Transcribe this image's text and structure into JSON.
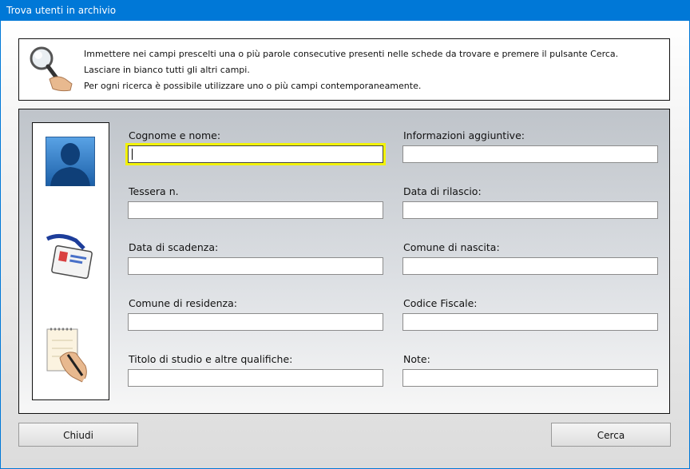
{
  "window": {
    "title": "Trova utenti in archivio"
  },
  "info": {
    "line1": "Immettere nei campi prescelti una o più parole consecutive presenti nelle schede da trovare e premere il pulsante Cerca.",
    "line2": "Lasciare in bianco tutti gli altri campi.",
    "line3": "Per ogni ricerca è possibile utilizzare uno o più campi contemporaneamente."
  },
  "fields": {
    "cognome_nome": {
      "label": "Cognome e nome:",
      "value": ""
    },
    "info_aggiuntive": {
      "label": "Informazioni aggiuntive:",
      "value": ""
    },
    "tessera": {
      "label": "Tessera n.",
      "value": ""
    },
    "data_rilascio": {
      "label": "Data di rilascio:",
      "value": ""
    },
    "data_scadenza": {
      "label": "Data di scadenza:",
      "value": ""
    },
    "comune_nascita": {
      "label": "Comune di nascita:",
      "value": ""
    },
    "comune_residenza": {
      "label": "Comune di residenza:",
      "value": ""
    },
    "codice_fiscale": {
      "label": "Codice Fiscale:",
      "value": ""
    },
    "titolo_studio": {
      "label": "Titolo di studio e altre qualifiche:",
      "value": ""
    },
    "note": {
      "label": "Note:",
      "value": ""
    }
  },
  "buttons": {
    "close": "Chiudi",
    "search": "Cerca"
  },
  "icons": [
    "magnifier-icon",
    "user-silhouette-icon",
    "id-badge-icon",
    "notepad-writing-icon"
  ],
  "colors": {
    "titlebar": "#0078d7",
    "focus_border": "#f2f20a"
  }
}
